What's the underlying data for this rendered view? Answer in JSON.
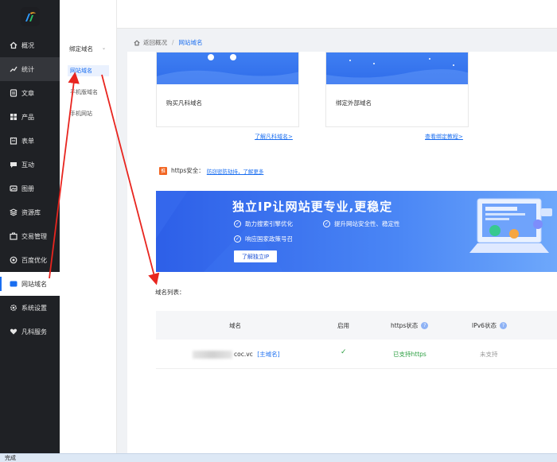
{
  "sidebar": {
    "items": [
      {
        "label": "概况",
        "icon": "home-icon"
      },
      {
        "label": "统计",
        "icon": "stats-icon"
      },
      {
        "label": "文章",
        "icon": "article-icon"
      },
      {
        "label": "产品",
        "icon": "grid-icon"
      },
      {
        "label": "表单",
        "icon": "form-icon"
      },
      {
        "label": "互动",
        "icon": "chat-icon"
      },
      {
        "label": "图册",
        "icon": "album-icon"
      },
      {
        "label": "资源库",
        "icon": "stack-icon"
      },
      {
        "label": "交易管理",
        "icon": "trade-icon"
      },
      {
        "label": "百度优化",
        "icon": "seo-icon"
      },
      {
        "label": "网站域名",
        "icon": "domain-icon"
      },
      {
        "label": "系统设置",
        "icon": "gear-icon"
      },
      {
        "label": "凡科服务",
        "icon": "heart-icon"
      }
    ]
  },
  "subnav": {
    "heading": "绑定域名",
    "items": [
      "网站域名",
      "手机版域名",
      "手机网站"
    ]
  },
  "breadcrumb": {
    "back": "返回概况",
    "sep": "/",
    "current": "网站域名"
  },
  "cards": {
    "buy": {
      "label": "购买凡科域名",
      "link": "了解凡科域名>"
    },
    "bind": {
      "label": "绑定外部域名",
      "link": "查看绑定教程>"
    }
  },
  "https": {
    "badge": "推",
    "label": "https安全：",
    "link": "防窃密防劫持，了解更多"
  },
  "banner": {
    "title": "独立IP让网站更专业,更稳定",
    "features": [
      "助力搜索引擎优化",
      "提升网站安全性、稳定性",
      "响应国家政策号召"
    ],
    "button": "了解独立IP"
  },
  "table": {
    "label": "域名列表：",
    "headers": {
      "domain": "域名",
      "enabled": "启用",
      "https": "https状态",
      "ipv6": "IPv6状态"
    },
    "rows": [
      {
        "domain": "coc.vc",
        "tag": "[主域名]",
        "enabled": "✓",
        "https": "已支持https",
        "ipv6": "未支持"
      }
    ]
  },
  "status": {
    "text": "完成"
  },
  "colors": {
    "accent": "#1a6ef0",
    "sidebar_bg": "#1f2125",
    "arrow": "#e8251f",
    "success": "#2ea043"
  }
}
